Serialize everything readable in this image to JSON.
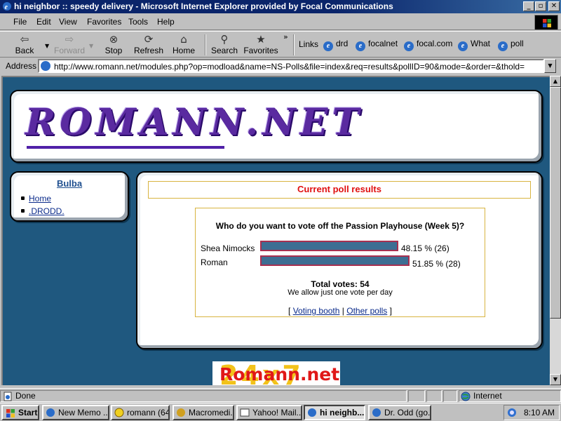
{
  "window": {
    "title": "hi neighbor :: speedy delivery - Microsoft Internet Explorer provided by Focal Communications",
    "minimize": "_",
    "maximize": "▫",
    "close": "✕"
  },
  "menu": [
    "File",
    "Edit",
    "View",
    "Favorites",
    "Tools",
    "Help"
  ],
  "toolbar": {
    "back": "Back",
    "forward": "Forward",
    "stop": "Stop",
    "refresh": "Refresh",
    "home": "Home",
    "search": "Search",
    "favorites": "Favorites",
    "links_label": "Links",
    "links": [
      "drd",
      "focalnet",
      "focal.com",
      "What",
      "poll"
    ]
  },
  "address": {
    "label": "Address",
    "url": "http://www.romann.net/modules.php?op=modload&name=NS-Polls&file=index&req=results&pollID=90&mode=&order=&thold="
  },
  "site": {
    "logo": "ROMANN.NET",
    "sidebar": {
      "title": "Bulba",
      "links": [
        "Home",
        ".DRODD."
      ]
    }
  },
  "poll": {
    "header": "Current poll results",
    "question": "Who do you want to vote off the Passion Playhouse (Week 5)?",
    "options": [
      {
        "name": "Shea Nimocks",
        "result": "48.15 % (26)",
        "percent": 48.15,
        "votes": 26
      },
      {
        "name": "Roman",
        "result": "51.85 % (28)",
        "percent": 51.85,
        "votes": 28
      }
    ],
    "total": "Total votes: 54",
    "note": "We allow just one vote per day",
    "link_open": "[",
    "voting_booth": "Voting booth",
    "link_sep": "|",
    "other_polls": "Other polls",
    "link_close": "]"
  },
  "banner": {
    "brand": "Romann.net",
    "bg_digits": "24x7"
  },
  "status": {
    "text": "Done",
    "zone": "Internet"
  },
  "taskbar": {
    "start": "Start",
    "tasks": [
      "New Memo ...",
      "romann (64....",
      "Macromedi...",
      "Yahoo! Mail...",
      "hi neighb...",
      "Dr. Odd (go..."
    ],
    "clock": "8:10 AM"
  },
  "colors": {
    "page_background": "#1f587f",
    "poll_header_text": "#e01010",
    "bar_fill": "#3d6e93",
    "bar_border": "#a83050",
    "title_bar": "#0a246a"
  }
}
